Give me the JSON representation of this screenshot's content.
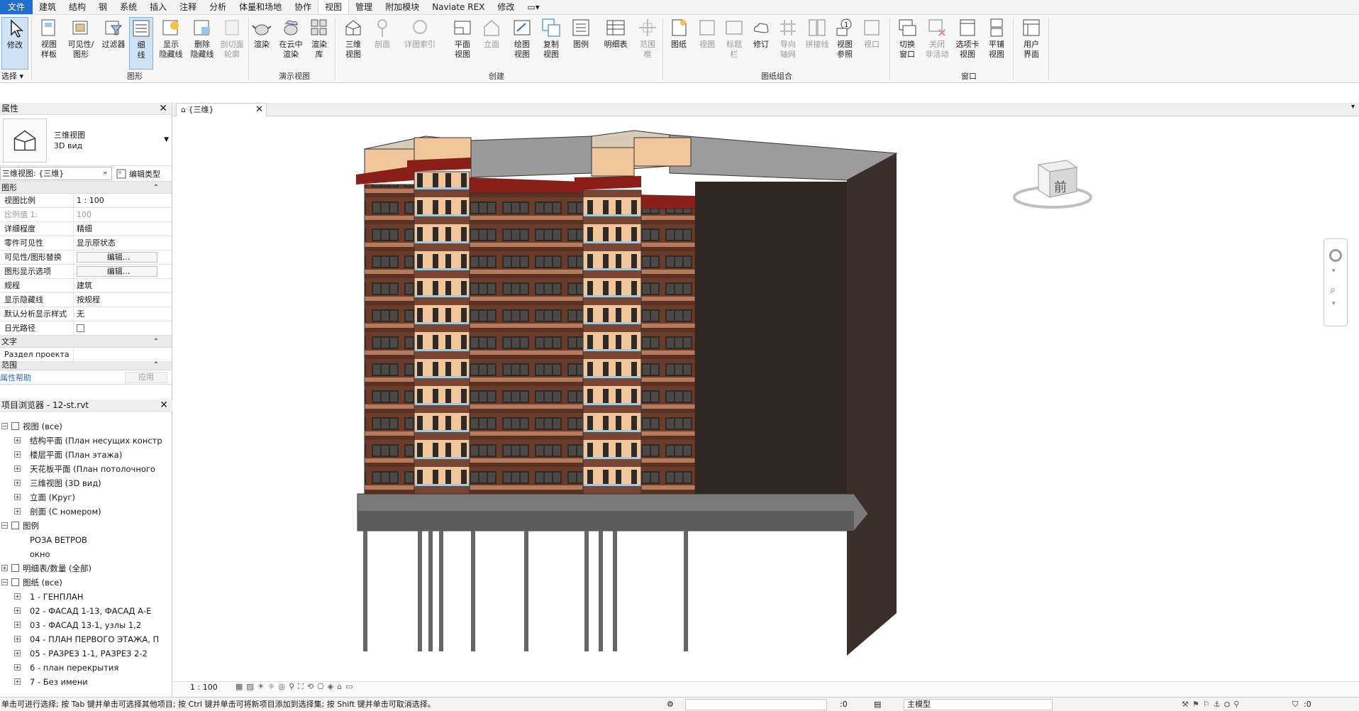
{
  "menu": [
    "文件",
    "建筑",
    "结构",
    "钢",
    "系统",
    "插入",
    "注释",
    "分析",
    "体量和场地",
    "协作",
    "视图",
    "管理",
    "附加模块",
    "Naviate REX",
    "修改",
    "▭▾"
  ],
  "ribbon": {
    "buttons": {
      "modify": "修改",
      "view_templates": "视图\n样板",
      "visibility": "可见性/\n图形",
      "filters": "过滤器",
      "thin_lines": "细\n线",
      "show_hidden": "显示\n隐藏线",
      "remove_hidden": "删除\n隐藏线",
      "cut_profile": "剖切面\n轮廓",
      "render": "渲染",
      "cloud_render": "在云中\n渲染",
      "render_gallery": "渲染\n库",
      "view_3d": "三维\n视图",
      "section": "剖面",
      "callout": "详图索引",
      "plan_views": "平面\n视图",
      "elevation": "立面",
      "drafting_view": "绘图\n视图",
      "duplicate_view": "复制\n视图",
      "legends": "图例",
      "schedules": "明细表",
      "scope_box": "范围\n框",
      "sheet": "图纸",
      "view": "视图",
      "title_block": "标题\n栏",
      "revisions": "修订",
      "guide_grid": "导向\n轴网",
      "matchline": "拼接线",
      "view_reference": "视图\n参照",
      "viewports": "视口",
      "switch_windows": "切换\n窗口",
      "close_inactive": "关闭\n非活动",
      "tab_views": "选项卡\n视图",
      "tile_views": "平铺\n视图",
      "user_interface": "用户\n界面"
    },
    "panels": {
      "select": "选择 ▾",
      "graphics": "图形",
      "presentation": "演示视图",
      "create": "创建",
      "sheet_composition": "图纸组合",
      "windows": "窗口"
    }
  },
  "properties": {
    "title": "属性",
    "type_name_1": "三维视图",
    "type_name_2": "3D вид",
    "selector": "三维视图: {三维}",
    "edit_type": "编辑类型",
    "group_graphics": "图形",
    "rows": [
      {
        "k": "视图比例",
        "v": "1 : 100",
        "dis": false,
        "btn": false
      },
      {
        "k": "比例值 1:",
        "v": "100",
        "dis": true,
        "btn": false
      },
      {
        "k": "详细程度",
        "v": "精细",
        "dis": false,
        "btn": false
      },
      {
        "k": "零件可见性",
        "v": "显示原状态",
        "dis": false,
        "btn": false
      },
      {
        "k": "可见性/图形替换",
        "v": "编辑...",
        "dis": false,
        "btn": true
      },
      {
        "k": "图形显示选项",
        "v": "编辑...",
        "dis": false,
        "btn": true
      },
      {
        "k": "规程",
        "v": "建筑",
        "dis": false,
        "btn": false
      },
      {
        "k": "显示隐藏线",
        "v": "按规程",
        "dis": false,
        "btn": false
      },
      {
        "k": "默认分析显示样式",
        "v": "无",
        "dis": false,
        "btn": false
      },
      {
        "k": "日光路径",
        "v": "",
        "dis": false,
        "btn": false
      }
    ],
    "group_text": "文字",
    "text_row": "Раздел проекта",
    "group_extents": "范围",
    "help_link": "属性帮助",
    "apply": "应用"
  },
  "browser": {
    "title": "项目浏览器 - 12-st.rvt",
    "items": [
      {
        "label": "视图 (все)",
        "level": 0,
        "exp": "-",
        "icon": "views"
      },
      {
        "label": "结构平面 (План несущих констр",
        "level": 1,
        "exp": "+",
        "icon": ""
      },
      {
        "label": "楼层平面 (План этажа)",
        "level": 1,
        "exp": "+",
        "icon": ""
      },
      {
        "label": "天花板平面 (План потолочного",
        "level": 1,
        "exp": "+",
        "icon": ""
      },
      {
        "label": "三维视图 (3D вид)",
        "level": 1,
        "exp": "+",
        "icon": ""
      },
      {
        "label": "立面 (Круг)",
        "level": 1,
        "exp": "+",
        "icon": ""
      },
      {
        "label": "剖面 (С номером)",
        "level": 1,
        "exp": "+",
        "icon": ""
      },
      {
        "label": "图例",
        "level": 0,
        "exp": "-",
        "icon": "legend"
      },
      {
        "label": "РОЗА ВЕТРОВ",
        "level": 1,
        "exp": "",
        "icon": ""
      },
      {
        "label": "окно",
        "level": 1,
        "exp": "",
        "icon": ""
      },
      {
        "label": "明细表/数量 (全部)",
        "level": 0,
        "exp": "+",
        "icon": "schedule"
      },
      {
        "label": "图纸 (все)",
        "level": 0,
        "exp": "-",
        "icon": "sheets"
      },
      {
        "label": "1 - ГЕНПЛАН",
        "level": 1,
        "exp": "+",
        "icon": ""
      },
      {
        "label": "02 - ФАСАД 1-13, ФАСАД А-Е",
        "level": 1,
        "exp": "+",
        "icon": ""
      },
      {
        "label": "03 - ФАСАД 13-1, узлы 1,2",
        "level": 1,
        "exp": "+",
        "icon": ""
      },
      {
        "label": "04 - ПЛАН ПЕРВОГО ЭТАЖА, П",
        "level": 1,
        "exp": "+",
        "icon": ""
      },
      {
        "label": "05 - РАЗРЕЗ 1-1, РАЗРЕЗ 2-2",
        "level": 1,
        "exp": "+",
        "icon": ""
      },
      {
        "label": "6 - план перекрытия",
        "level": 1,
        "exp": "+",
        "icon": ""
      },
      {
        "label": "7 - Без имени",
        "level": 1,
        "exp": "+",
        "icon": ""
      }
    ]
  },
  "view_tab": {
    "label": "{三维}"
  },
  "viewcube": {
    "face": "前"
  },
  "view_scale": "1 : 100",
  "status": {
    "message": "单击可进行选择; 按 Tab 键并单击可选择其他项目; 按 Ctrl 键并单击可将新项目添加到选择集; 按 Shift 键并单击可取消选择。",
    "count_left": ":0",
    "model": "主模型",
    "filter_count": ":0"
  }
}
